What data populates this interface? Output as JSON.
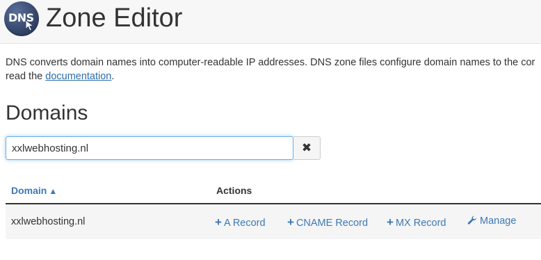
{
  "header": {
    "logo_text": "DNS",
    "title": "Zone Editor"
  },
  "description": {
    "text": "DNS converts domain names into computer-readable IP addresses. DNS zone files configure domain names to the cor",
    "text_line2": "read the ",
    "link": "documentation",
    "suffix": "."
  },
  "domains": {
    "heading": "Domains",
    "search_value": "xxlwebhosting.nl",
    "clear_icon": "times-icon"
  },
  "table": {
    "columns": {
      "domain": "Domain",
      "actions": "Actions"
    },
    "sort_icon": "sort-ascending-icon",
    "rows": [
      {
        "domain": "xxlwebhosting.nl",
        "actions": [
          "A Record",
          "CNAME Record",
          "MX Record",
          "Manage"
        ]
      }
    ]
  },
  "colors": {
    "link": "#3d79b6",
    "text": "#333333",
    "row_bg": "#f5f5f5",
    "logo_bg": "#2f3f63"
  }
}
